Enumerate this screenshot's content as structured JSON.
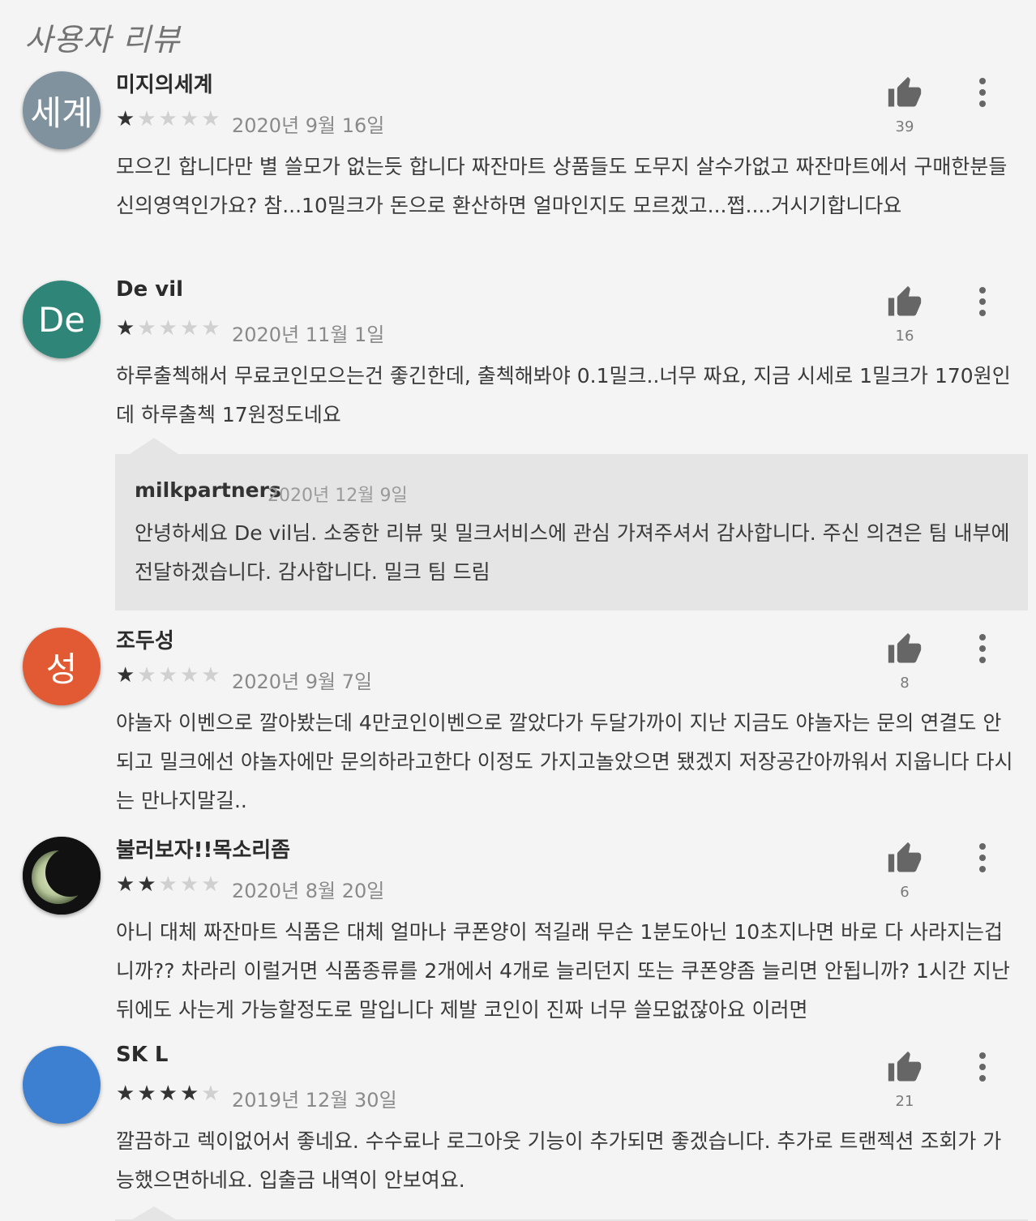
{
  "section_title": "사용자 리뷰",
  "reviews": [
    {
      "author": "미지의세계",
      "avatar_text": "세계",
      "avatar_color": "#7f929e",
      "rating": 1,
      "date": "2020년 9월 16일",
      "likes": "39",
      "text": "모으긴 합니다만 별 쓸모가 없는듯 합니다 짜잔마트 상품들도 도무지 살수가없고 짜잔마트에서 구매한분들 신의영역인가요? 참...10밀크가 돈으로 환산하면 얼마인지도 모르겠고...쩝....거시기합니다요"
    },
    {
      "author": "De vil",
      "avatar_text": "De",
      "avatar_color": "#2f8577",
      "rating": 1,
      "date": "2020년 11월 1일",
      "likes": "16",
      "text": "하루출첵해서 무료코인모으는건 좋긴한데, 출첵해봐야 0.1밀크..너무 짜요, 지금 시세로 1밀크가 170원인데 하루출첵 17원정도네요",
      "reply": {
        "author": "milkpartners",
        "date": "2020년 12월 9일",
        "text": "안녕하세요 De vil님. 소중한 리뷰 및 밀크서비스에 관심 가져주셔서 감사합니다. 주신 의견은 팀 내부에 전달하겠습니다. 감사합니다. 밀크 팀 드림"
      }
    },
    {
      "author": "조두성",
      "avatar_text": "성",
      "avatar_color": "#e25a33",
      "rating": 1,
      "date": "2020년 9월 7일",
      "likes": "8",
      "text": "야놀자 이벤으로 깔아봤는데 4만코인이벤으로 깔았다가 두달가까이 지난 지금도 야놀자는 문의 연결도 안되고 밀크에선 야놀자에만 문의하라고한다 이정도 가지고놀았으면 됐겠지 저장공간아까워서 지웁니다 다시는 만나지말길.."
    },
    {
      "author": "불러보자!!목소리좀",
      "avatar_text": "",
      "avatar_color": "#1a1a1a",
      "rating": 2,
      "date": "2020년 8월 20일",
      "likes": "6",
      "text": "아니 대체 짜잔마트 식품은 대체 얼마나 쿠폰양이 적길래 무슨 1분도아닌 10초지나면 바로 다 사라지는겁니까?? 차라리 이럴거면 식품종류를 2개에서 4개로 늘리던지 또는 쿠폰양좀 늘리면 안됩니까? 1시간 지난뒤에도 사는게 가능할정도로 말입니다 제발 코인이 진짜 너무 쓸모없잖아요 이러면"
    },
    {
      "author": "SK L",
      "avatar_text": "",
      "avatar_color": "#3d7fd0",
      "rating": 4,
      "date": "2019년 12월 30일",
      "likes": "21",
      "text": "깔끔하고 렉이없어서 좋네요. 수수료나 로그아웃 기능이 추가되면 좋겠습니다. 추가로 트랜젝션 조회가 가능했으면하네요. 입출금 내역이 안보여요."
    }
  ]
}
